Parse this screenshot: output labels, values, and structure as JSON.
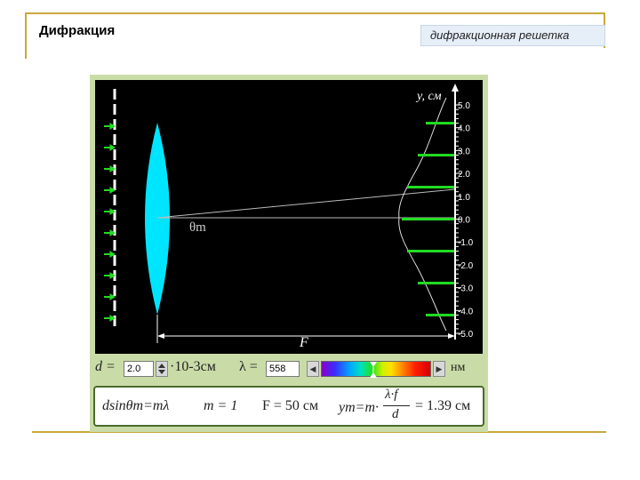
{
  "slide": {
    "title": "Дифракция",
    "subtitle": "дифракционная решетка"
  },
  "sim": {
    "axis_label": "y, см",
    "ticks": [
      "5.0",
      "4.0",
      "3.0",
      "2.0",
      "1.0",
      "0.0",
      "-1.0",
      "-2.0",
      "-3.0",
      "-4.0",
      "-5.0"
    ],
    "angle_label": "θm",
    "focal_label": "F",
    "colors": {
      "background": "#000000",
      "lens": "#00e5ff",
      "maxima": "#22dd22",
      "axis": "#ffffff"
    }
  },
  "controls": {
    "d_label": "d =",
    "d_value": "2.0",
    "d_unit": "·10-3см",
    "lambda_label": "λ =",
    "lambda_value": "558",
    "lambda_unit": "нм"
  },
  "formula": {
    "grating_eq": "dsinθm=mλ",
    "order": "m = 1",
    "focal": "F = 50 см",
    "ym_lhs": "ym=m·",
    "numerator": "λ·f",
    "denominator": "d",
    "result": "= 1.39 см"
  }
}
